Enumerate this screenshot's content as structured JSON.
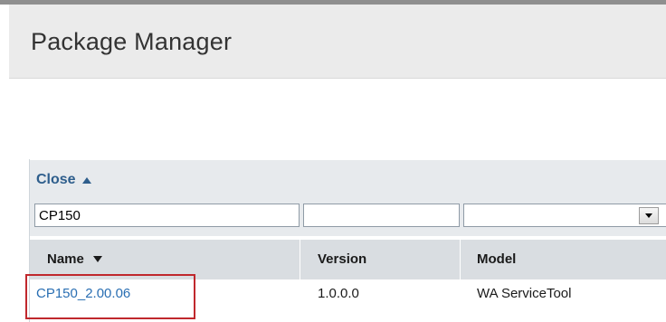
{
  "header": {
    "title": "Package Manager"
  },
  "filter_panel": {
    "toggle_label": "Close",
    "name_filter_value": "CP150",
    "version_filter_value": "",
    "model_filter_value": ""
  },
  "table": {
    "columns": [
      {
        "label": "Name",
        "sorted": "descending"
      },
      {
        "label": "Version"
      },
      {
        "label": "Model"
      }
    ],
    "rows": [
      {
        "name": "CP150_2.00.06",
        "version": "1.0.0.0",
        "model": "WA ServiceTool"
      }
    ]
  },
  "colors": {
    "link": "#2a6fb3",
    "panel_header": "#2e5e8c",
    "highlight": "#c0282d",
    "table_header_bg": "#d9dde1"
  },
  "icons": {
    "collapse": "triangle-up-icon",
    "sort": "triangle-down-icon",
    "dropdown": "dropdown-arrow-icon"
  }
}
